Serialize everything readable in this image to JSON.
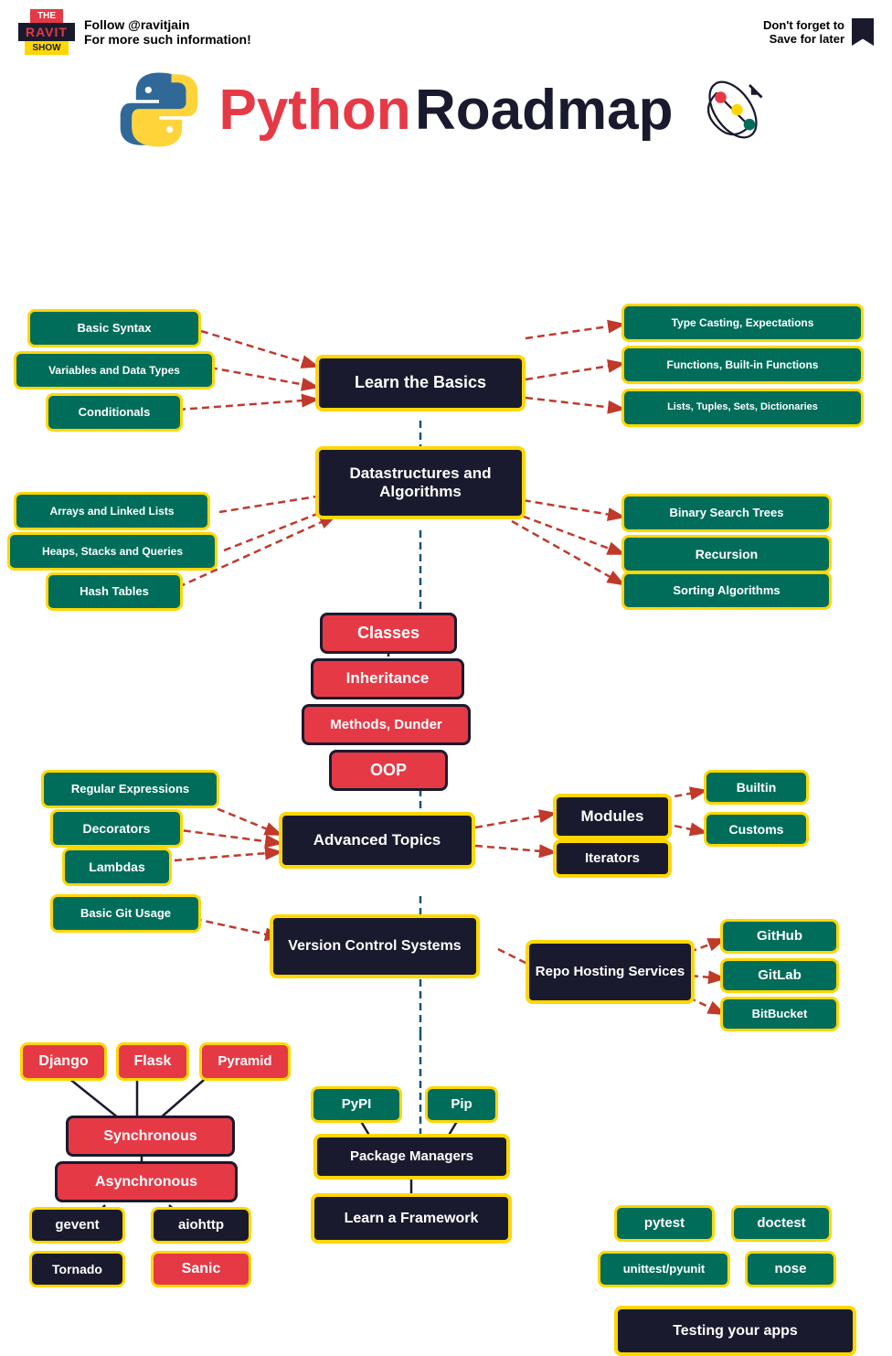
{
  "header": {
    "logo_line1": "THE",
    "logo_line2": "RAVIT",
    "logo_line3": "SHOW",
    "follow_text": "Follow @ravitjain",
    "follow_sub": "For more such information!",
    "save_text": "Don't forget to\nSave for later"
  },
  "title": {
    "python": "Python",
    "roadmap": "Roadmap"
  },
  "nodes": {
    "learn_basics": "Learn the Basics",
    "ds_algorithms": "Datastructures\nand Algorithms",
    "basic_syntax": "Basic Syntax",
    "variables": "Variables and Data Types",
    "conditionals": "Conditionals",
    "type_casting": "Type Casting, Expectations",
    "functions": "Functions, Built-in Functions",
    "lists_tuples": "Lists, Tuples, Sets, Dictionaries",
    "arrays": "Arrays and Linked Lists",
    "heaps": "Heaps, Stacks and Queries",
    "hash_tables": "Hash Tables",
    "binary_search": "Binary Search Trees",
    "recursion": "Recursion",
    "sorting": "Sorting Algorithms",
    "classes": "Classes",
    "inheritance": "Inheritance",
    "methods_dunder": "Methods, Dunder",
    "oop": "OOP",
    "regular_expr": "Regular Expressions",
    "decorators": "Decorators",
    "lambdas": "Lambdas",
    "advanced_topics": "Advanced Topics",
    "modules": "Modules",
    "iterators": "Iterators",
    "builtin": "Builtin",
    "customs": "Customs",
    "basic_git": "Basic Git Usage",
    "version_control": "Version Control\nSystems",
    "repo_hosting": "Repo Hosting\nServices",
    "github": "GitHub",
    "gitlab": "GitLab",
    "bitbucket": "BitBucket",
    "django": "Django",
    "flask": "Flask",
    "pyramid": "Pyramid",
    "synchronous": "Synchronous",
    "asynchronous": "Asynchronous",
    "gevent": "gevent",
    "aiohttp": "aiohttp",
    "tornado": "Tornado",
    "sanic": "Sanic",
    "pypi": "PyPI",
    "pip": "Pip",
    "package_managers": "Package Managers",
    "learn_framework": "Learn a Framework",
    "pytest": "pytest",
    "doctest": "doctest",
    "unittest": "unittest/pyunit",
    "nose": "nose",
    "testing": "Testing your apps"
  }
}
